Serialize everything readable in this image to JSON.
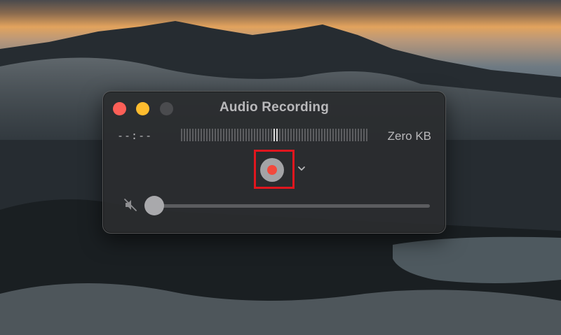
{
  "window": {
    "title": "Audio Recording"
  },
  "recording": {
    "elapsed_time": "--:--",
    "file_size": "Zero KB"
  },
  "icons": {
    "close": "close-traffic-light",
    "minimize": "minimize-traffic-light",
    "zoom": "zoom-traffic-light-disabled",
    "record": "record-icon",
    "options": "chevron-down-icon",
    "mute": "speaker-muted-icon"
  },
  "volume": {
    "level": 0
  },
  "colors": {
    "close": "#fd5f57",
    "minimize": "#febc2e",
    "zoom_disabled": "#4a4b4e",
    "record_dot": "#f2493d",
    "highlight_box": "#e0161e"
  }
}
